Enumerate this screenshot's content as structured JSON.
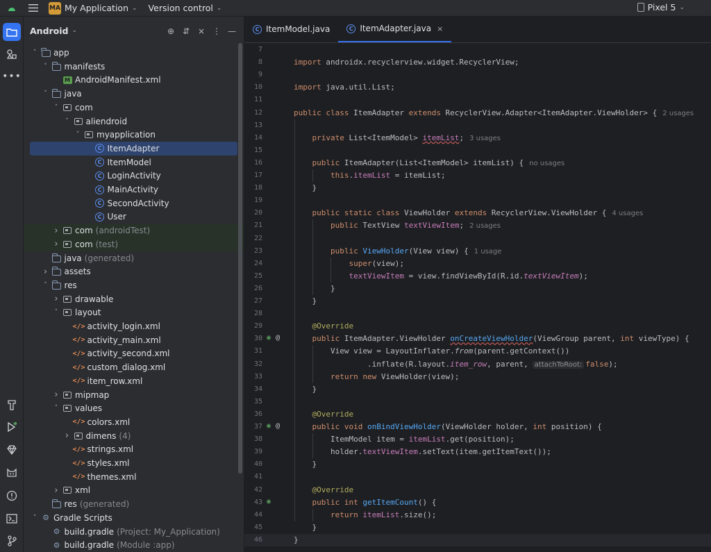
{
  "titlebar": {
    "project_badge": "MA",
    "project_name": "My Application",
    "version_control": "Version control",
    "device": "Pixel 5"
  },
  "panel": {
    "title": "Android",
    "tree": [
      {
        "label": "app",
        "icon": "folder",
        "arrow": "down",
        "indent": 0
      },
      {
        "label": "manifests",
        "icon": "folder",
        "arrow": "down",
        "indent": 1
      },
      {
        "label": "AndroidManifest.xml",
        "icon": "manifest",
        "arrow": "",
        "indent": 2
      },
      {
        "label": "java",
        "icon": "folder",
        "arrow": "down",
        "indent": 1
      },
      {
        "label": "com",
        "icon": "package",
        "arrow": "down",
        "indent": 2
      },
      {
        "label": "aliendroid",
        "icon": "package",
        "arrow": "down",
        "indent": 3
      },
      {
        "label": "myapplication",
        "icon": "package",
        "arrow": "down",
        "indent": 4
      },
      {
        "label": "ItemAdapter",
        "icon": "class",
        "arrow": "",
        "indent": 5,
        "selected": true
      },
      {
        "label": "ItemModel",
        "icon": "class",
        "arrow": "",
        "indent": 5
      },
      {
        "label": "LoginActivity",
        "icon": "class",
        "arrow": "",
        "indent": 5
      },
      {
        "label": "MainActivity",
        "icon": "class",
        "arrow": "",
        "indent": 5
      },
      {
        "label": "SecondActivity",
        "icon": "class",
        "arrow": "",
        "indent": 5
      },
      {
        "label": "User",
        "icon": "class",
        "arrow": "",
        "indent": 5
      },
      {
        "label": "com",
        "suffix": "(androidTest)",
        "icon": "package",
        "arrow": "right",
        "indent": 2,
        "test": true
      },
      {
        "label": "com",
        "suffix": "(test)",
        "icon": "package",
        "arrow": "right",
        "indent": 2,
        "test": true
      },
      {
        "label": "java",
        "suffix": "(generated)",
        "icon": "folder",
        "arrow": "",
        "indent": 1
      },
      {
        "label": "assets",
        "icon": "folder",
        "arrow": "right",
        "indent": 1
      },
      {
        "label": "res",
        "icon": "folder",
        "arrow": "down",
        "indent": 1
      },
      {
        "label": "drawable",
        "icon": "package",
        "arrow": "right",
        "indent": 2
      },
      {
        "label": "layout",
        "icon": "package",
        "arrow": "down",
        "indent": 2
      },
      {
        "label": "activity_login.xml",
        "icon": "xml",
        "arrow": "",
        "indent": 3
      },
      {
        "label": "activity_main.xml",
        "icon": "xml",
        "arrow": "",
        "indent": 3
      },
      {
        "label": "activity_second.xml",
        "icon": "xml",
        "arrow": "",
        "indent": 3
      },
      {
        "label": "custom_dialog.xml",
        "icon": "xml",
        "arrow": "",
        "indent": 3
      },
      {
        "label": "item_row.xml",
        "icon": "xml",
        "arrow": "",
        "indent": 3
      },
      {
        "label": "mipmap",
        "icon": "package",
        "arrow": "right",
        "indent": 2
      },
      {
        "label": "values",
        "icon": "package",
        "arrow": "down",
        "indent": 2
      },
      {
        "label": "colors.xml",
        "icon": "xml",
        "arrow": "",
        "indent": 3
      },
      {
        "label": "dimens",
        "suffix": "(4)",
        "icon": "package",
        "arrow": "right",
        "indent": 3
      },
      {
        "label": "strings.xml",
        "icon": "xml",
        "arrow": "",
        "indent": 3
      },
      {
        "label": "styles.xml",
        "icon": "xml",
        "arrow": "",
        "indent": 3
      },
      {
        "label": "themes.xml",
        "icon": "xml",
        "arrow": "",
        "indent": 3
      },
      {
        "label": "xml",
        "icon": "package",
        "arrow": "right",
        "indent": 2
      },
      {
        "label": "res",
        "suffix": "(generated)",
        "icon": "folder",
        "arrow": "",
        "indent": 1
      },
      {
        "label": "Gradle Scripts",
        "icon": "gradle",
        "arrow": "down",
        "indent": 0
      },
      {
        "label": "build.gradle",
        "suffix": "(Project: My_Application)",
        "icon": "gradle",
        "arrow": "",
        "indent": 1
      },
      {
        "label": "build.gradle",
        "suffix": "(Module :app)",
        "icon": "gradle",
        "arrow": "",
        "indent": 1
      }
    ]
  },
  "editor": {
    "tabs": [
      {
        "label": "ItemModel.java",
        "active": false
      },
      {
        "label": "ItemAdapter.java",
        "active": true,
        "close": "×"
      }
    ],
    "current_line": "46",
    "lines": [
      {
        "n": "7",
        "html": ""
      },
      {
        "n": "8",
        "html": "<span class='kw'>import</span> androidx.recyclerview.widget.RecyclerView;"
      },
      {
        "n": "9",
        "html": ""
      },
      {
        "n": "10",
        "html": "<span class='kw'>import</span> java.util.List;"
      },
      {
        "n": "11",
        "html": ""
      },
      {
        "n": "12",
        "html": "<span class='kw'>public class</span> ItemAdapter <span class='kw'>extends</span> RecyclerView.Adapter&lt;ItemAdapter.ViewHolder&gt; {<span class='hint'>2 usages</span>"
      },
      {
        "n": "13",
        "html": ""
      },
      {
        "n": "14",
        "html": "    <span class='kw'>private</span> List&lt;ItemModel&gt; <span class='fld und'>itemList</span>;<span class='hint'>3 usages</span>"
      },
      {
        "n": "15",
        "html": ""
      },
      {
        "n": "16",
        "html": "    <span class='kw'>public</span> ItemAdapter(List&lt;ItemModel&gt; itemList) {<span class='hint'>no usages</span>"
      },
      {
        "n": "17",
        "html": "        <span class='kw'>this</span>.<span class='fld'>itemList</span> = itemList;"
      },
      {
        "n": "18",
        "html": "    }"
      },
      {
        "n": "19",
        "html": ""
      },
      {
        "n": "20",
        "html": "    <span class='kw'>public static class</span> ViewHolder <span class='kw'>extends</span> RecyclerView.ViewHolder {<span class='hint'>4 usages</span>"
      },
      {
        "n": "21",
        "html": "        <span class='kw'>public</span> TextView <span class='fld'>textViewItem</span>;<span class='hint'>2 usages</span>"
      },
      {
        "n": "22",
        "html": ""
      },
      {
        "n": "23",
        "html": "        <span class='kw'>public</span> <span class='fn'>ViewHolder</span>(View view) {<span class='hint'>1 usage</span>"
      },
      {
        "n": "24",
        "html": "            <span class='kw'>super</span>(view);"
      },
      {
        "n": "25",
        "html": "            <span class='fld'>textViewItem</span> = view.findViewById(R.id.<span class='fld it'>textViewItem</span>);"
      },
      {
        "n": "26",
        "html": "        }"
      },
      {
        "n": "27",
        "html": "    }"
      },
      {
        "n": "28",
        "html": ""
      },
      {
        "n": "29",
        "html": "    <span class='ann'>@Override</span>"
      },
      {
        "n": "30",
        "html": "    <span class='kw'>public</span> ItemAdapter.ViewHolder <span class='fn und'>onCreateViewHolder</span>(ViewGroup parent, <span class='kw'>int</span> viewType) {"
      },
      {
        "n": "31",
        "html": "        View view = LayoutInflater.<span class='it'>from</span>(parent.getContext())"
      },
      {
        "n": "32",
        "html": "                .inflate(R.layout.<span class='fld it'>item_row</span>, parent,<span class='hintbox'>attachToRoot:</span><span class='kw'>false</span>);"
      },
      {
        "n": "33",
        "html": "        <span class='kw'>return new</span> ViewHolder(view);"
      },
      {
        "n": "34",
        "html": "    }"
      },
      {
        "n": "35",
        "html": ""
      },
      {
        "n": "36",
        "html": "    <span class='ann'>@Override</span>"
      },
      {
        "n": "37",
        "html": "    <span class='kw'>public void</span> <span class='fn'>onBindViewHolder</span>(ViewHolder holder, <span class='kw'>int</span> position) {"
      },
      {
        "n": "38",
        "html": "        ItemModel item = <span class='fld'>itemList</span>.get(position);"
      },
      {
        "n": "39",
        "html": "        holder.<span class='fld'>textViewItem</span>.setText(item.getItemText());"
      },
      {
        "n": "40",
        "html": "    }"
      },
      {
        "n": "41",
        "html": ""
      },
      {
        "n": "42",
        "html": "    <span class='ann'>@Override</span>"
      },
      {
        "n": "43",
        "html": "    <span class='kw'>public int</span> <span class='fn'>getItemCount</span>() {"
      },
      {
        "n": "44",
        "html": "        <span class='kw'>return</span> <span class='fld'>itemList</span>.size();"
      },
      {
        "n": "45",
        "html": "    }"
      },
      {
        "n": "46",
        "html": "}"
      }
    ],
    "gutter_marks": [
      {
        "line": "30",
        "icon": "override-icon",
        "at": true
      },
      {
        "line": "37",
        "icon": "override-icon",
        "at": true
      },
      {
        "line": "43",
        "icon": "override-icon",
        "at": false
      }
    ]
  },
  "colors": {
    "accent": "#3574f0",
    "selection": "#2e436e",
    "keyword": "#cf8e6d",
    "field": "#c77dbb",
    "function": "#56a8f5",
    "annotation": "#b3ae60"
  }
}
